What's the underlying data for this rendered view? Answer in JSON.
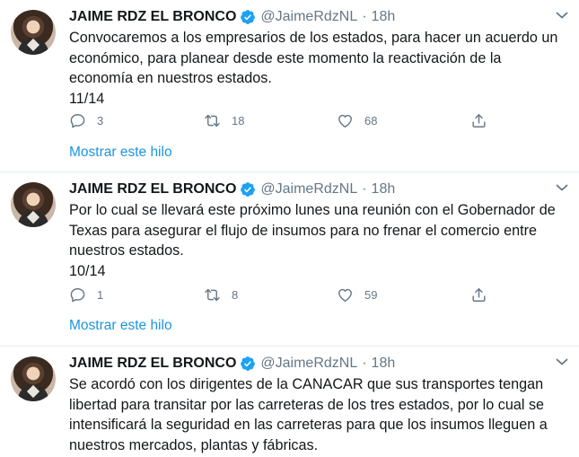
{
  "tweets": [
    {
      "author": {
        "name": "JAIME RDZ EL BRONCO",
        "handle": "@JaimeRdzNL",
        "time": "18h"
      },
      "text": "Convocaremos a los empresarios de los estados, para hacer un acuerdo un\neconómico, para planear desde este momento la reactivación de la\neconomía en nuestros estados.\n11/14",
      "replies": "3",
      "retweets": "18",
      "likes": "68",
      "show_thread": "Mostrar este hilo"
    },
    {
      "author": {
        "name": "JAIME RDZ EL BRONCO",
        "handle": "@JaimeRdzNL",
        "time": "18h"
      },
      "text": "Por lo cual se llevará este próximo lunes una reunión con el Gobernador de\nTexas para asegurar el flujo de insumos para no frenar el comercio entre\nnuestros estados.\n10/14",
      "replies": "1",
      "retweets": "8",
      "likes": "59",
      "show_thread": "Mostrar este hilo"
    },
    {
      "author": {
        "name": "JAIME RDZ EL BRONCO",
        "handle": "@JaimeRdzNL",
        "time": "18h"
      },
      "text": "Se acordó con los dirigentes de la CANACAR que sus transportes tengan\nlibertad para transitar por las carreteras de los tres estados, por lo cual se\nintensificará la seguridad en las carreteras para que los insumos lleguen a\nnuestros mercados, plantas y fábricas."
    }
  ],
  "separator": "·",
  "icons": [
    "verified-badge-icon",
    "chevron-down-icon",
    "reply-icon",
    "retweet-icon",
    "like-icon",
    "share-icon"
  ],
  "colors": {
    "accent": "#1b95e0",
    "secondary_text": "#657786",
    "text": "#14171a",
    "divider": "#e6ecf0",
    "verified": "#1da1f2"
  }
}
